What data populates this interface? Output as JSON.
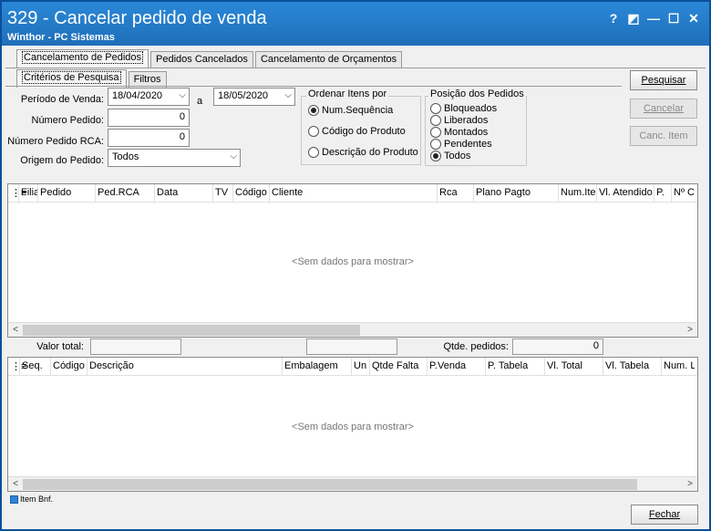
{
  "window": {
    "title": "329 - Cancelar pedido de venda",
    "subtitle": "Winthor - PC Sistemas",
    "icons": [
      "help-icon",
      "restore-icon",
      "minimize-icon",
      "maximize-icon",
      "close-icon"
    ],
    "icon_glyphs": [
      "?",
      "◩",
      "—",
      "☐",
      "✕"
    ]
  },
  "tabs_top": [
    "Cancelamento de Pedidos",
    "Pedidos Cancelados",
    "Cancelamento de Orçamentos"
  ],
  "tabs_sub": [
    "Critérios de Pesquisa",
    "Filtros"
  ],
  "form": {
    "periodo_label": "Período de Venda:",
    "date_from": "18/04/2020",
    "date_sep": "a",
    "date_to": "18/05/2020",
    "numero_pedido_label": "Número Pedido:",
    "numero_pedido_value": "0",
    "numero_rca_label": "Número Pedido RCA:",
    "numero_rca_value": "0",
    "origem_label": "Origem do Pedido:",
    "origem_value": "Todos"
  },
  "ordenar": {
    "title": "Ordenar Itens por",
    "options": [
      "Num.Sequência",
      "Código do Produto",
      "Descrição do Produto"
    ],
    "selected": 0
  },
  "posicao": {
    "title": "Posição dos Pedidos",
    "options": [
      "Bloqueados",
      "Liberados",
      "Montados",
      "Pendentes",
      "Todos"
    ],
    "selected": 4
  },
  "buttons": {
    "pesquisar": "Pesquisar",
    "cancelar": "Cancelar",
    "canc_item": "Canc. Item",
    "fechar": "Fechar"
  },
  "grid_pedidos": {
    "columns": [
      "Filia",
      "Pedido",
      "Ped.RCA",
      "Data",
      "TV",
      "Código",
      "Cliente",
      "Rca",
      "Plano Pagto",
      "Num.Itens",
      "Vl. Atendido",
      "P.",
      "Nº Ca"
    ],
    "empty_text": "<Sem dados para mostrar>"
  },
  "totals": {
    "valor_total_label": "Valor total:",
    "valor_total_value": "",
    "middle_value": "",
    "qtde_label": "Qtde. pedidos:",
    "qtde_value": "0"
  },
  "grid_itens": {
    "columns": [
      "Seq.",
      "Código",
      "Descrição",
      "Embalagem",
      "Un",
      "Qtde Falta",
      "P.Venda",
      "P. Tabela",
      "Vl. Total",
      "Vl. Tabela",
      "Num. Lo"
    ],
    "empty_text": "<Sem dados para mostrar>"
  },
  "legend": {
    "label": "Item Bnf.",
    "color": "#2f84d6"
  }
}
